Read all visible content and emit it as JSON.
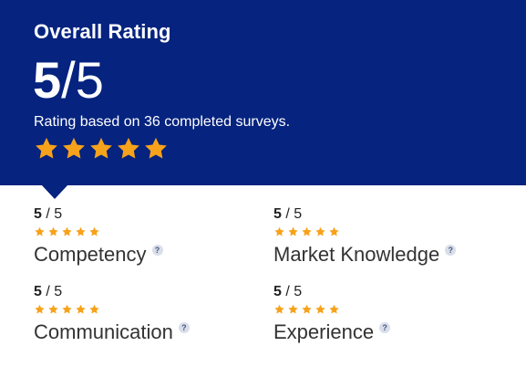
{
  "overall": {
    "title": "Overall Rating",
    "score": "5",
    "separator": "/",
    "out_of": "5",
    "subtitle": "Rating based on 36 completed surveys.",
    "stars_filled": 5,
    "stars_total": 5
  },
  "metrics": [
    {
      "score": "5",
      "score_rest": " / 5",
      "stars_filled": 5,
      "label": "Competency",
      "help": "?"
    },
    {
      "score": "5",
      "score_rest": " / 5",
      "stars_filled": 5,
      "label": "Market Knowledge",
      "help": "?"
    },
    {
      "score": "5",
      "score_rest": " / 5",
      "stars_filled": 5,
      "label": "Communication",
      "help": "?"
    },
    {
      "score": "5",
      "score_rest": " / 5",
      "stars_filled": 5,
      "label": "Experience",
      "help": "?"
    }
  ],
  "colors": {
    "hero_background": "#05237f",
    "star": "#f7a21b",
    "hero_text": "#ffffff",
    "body_text": "#333333"
  },
  "icons": {
    "star": "star-icon",
    "help": "help-icon"
  }
}
